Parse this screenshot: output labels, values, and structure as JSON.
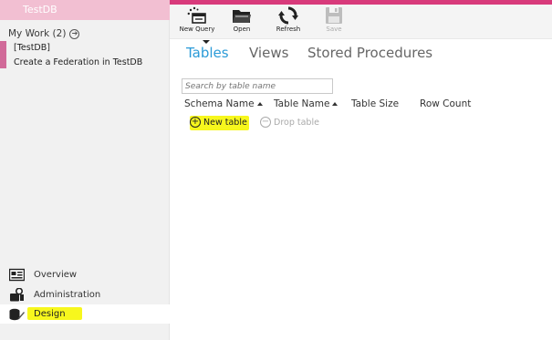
{
  "sidebar": {
    "db_title": "TestDB",
    "my_work": "My Work (2)",
    "work_items": [
      "[TestDB]",
      "Create a Federation in TestDB"
    ],
    "nav": {
      "overview": "Overview",
      "administration": "Administration",
      "design": "Design"
    },
    "selected": "Design"
  },
  "toolbar": {
    "new_query": "New Query",
    "open": "Open",
    "refresh": "Refresh",
    "save": "Save"
  },
  "tabs": {
    "tables": "Tables",
    "views": "Views",
    "stored_procedures": "Stored Procedures",
    "active": "Tables"
  },
  "search": {
    "placeholder": "Search by table name"
  },
  "columns": {
    "schema_name": "Schema Name",
    "table_name": "Table Name",
    "table_size": "Table Size",
    "row_count": "Row Count"
  },
  "actions": {
    "new_table": "New table",
    "drop_table": "Drop table"
  },
  "colors": {
    "accent_pink": "#d83a7b",
    "header_pink": "#f2bfd2",
    "tab_active": "#2b9bd8",
    "highlight": "#f7f71d"
  },
  "icons": {
    "overview": "overview-icon",
    "administration": "administration-icon",
    "design": "design-icon",
    "new_query": "new-query-icon",
    "open": "folder-open-icon",
    "refresh": "refresh-icon",
    "save": "save-icon"
  }
}
